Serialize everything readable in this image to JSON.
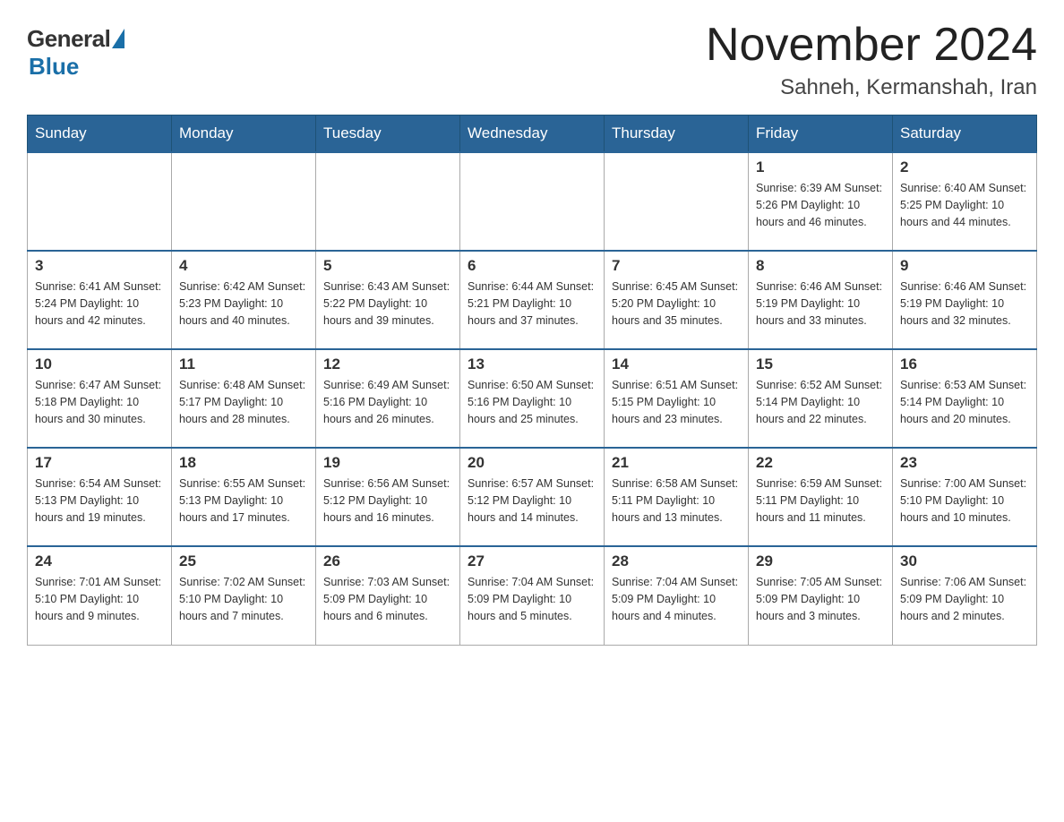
{
  "header": {
    "logo_general": "General",
    "logo_blue": "Blue",
    "month_title": "November 2024",
    "location": "Sahneh, Kermanshah, Iran"
  },
  "days_of_week": [
    "Sunday",
    "Monday",
    "Tuesday",
    "Wednesday",
    "Thursday",
    "Friday",
    "Saturday"
  ],
  "weeks": [
    {
      "days": [
        {
          "num": "",
          "info": ""
        },
        {
          "num": "",
          "info": ""
        },
        {
          "num": "",
          "info": ""
        },
        {
          "num": "",
          "info": ""
        },
        {
          "num": "",
          "info": ""
        },
        {
          "num": "1",
          "info": "Sunrise: 6:39 AM\nSunset: 5:26 PM\nDaylight: 10 hours and 46 minutes."
        },
        {
          "num": "2",
          "info": "Sunrise: 6:40 AM\nSunset: 5:25 PM\nDaylight: 10 hours and 44 minutes."
        }
      ]
    },
    {
      "days": [
        {
          "num": "3",
          "info": "Sunrise: 6:41 AM\nSunset: 5:24 PM\nDaylight: 10 hours and 42 minutes."
        },
        {
          "num": "4",
          "info": "Sunrise: 6:42 AM\nSunset: 5:23 PM\nDaylight: 10 hours and 40 minutes."
        },
        {
          "num": "5",
          "info": "Sunrise: 6:43 AM\nSunset: 5:22 PM\nDaylight: 10 hours and 39 minutes."
        },
        {
          "num": "6",
          "info": "Sunrise: 6:44 AM\nSunset: 5:21 PM\nDaylight: 10 hours and 37 minutes."
        },
        {
          "num": "7",
          "info": "Sunrise: 6:45 AM\nSunset: 5:20 PM\nDaylight: 10 hours and 35 minutes."
        },
        {
          "num": "8",
          "info": "Sunrise: 6:46 AM\nSunset: 5:19 PM\nDaylight: 10 hours and 33 minutes."
        },
        {
          "num": "9",
          "info": "Sunrise: 6:46 AM\nSunset: 5:19 PM\nDaylight: 10 hours and 32 minutes."
        }
      ]
    },
    {
      "days": [
        {
          "num": "10",
          "info": "Sunrise: 6:47 AM\nSunset: 5:18 PM\nDaylight: 10 hours and 30 minutes."
        },
        {
          "num": "11",
          "info": "Sunrise: 6:48 AM\nSunset: 5:17 PM\nDaylight: 10 hours and 28 minutes."
        },
        {
          "num": "12",
          "info": "Sunrise: 6:49 AM\nSunset: 5:16 PM\nDaylight: 10 hours and 26 minutes."
        },
        {
          "num": "13",
          "info": "Sunrise: 6:50 AM\nSunset: 5:16 PM\nDaylight: 10 hours and 25 minutes."
        },
        {
          "num": "14",
          "info": "Sunrise: 6:51 AM\nSunset: 5:15 PM\nDaylight: 10 hours and 23 minutes."
        },
        {
          "num": "15",
          "info": "Sunrise: 6:52 AM\nSunset: 5:14 PM\nDaylight: 10 hours and 22 minutes."
        },
        {
          "num": "16",
          "info": "Sunrise: 6:53 AM\nSunset: 5:14 PM\nDaylight: 10 hours and 20 minutes."
        }
      ]
    },
    {
      "days": [
        {
          "num": "17",
          "info": "Sunrise: 6:54 AM\nSunset: 5:13 PM\nDaylight: 10 hours and 19 minutes."
        },
        {
          "num": "18",
          "info": "Sunrise: 6:55 AM\nSunset: 5:13 PM\nDaylight: 10 hours and 17 minutes."
        },
        {
          "num": "19",
          "info": "Sunrise: 6:56 AM\nSunset: 5:12 PM\nDaylight: 10 hours and 16 minutes."
        },
        {
          "num": "20",
          "info": "Sunrise: 6:57 AM\nSunset: 5:12 PM\nDaylight: 10 hours and 14 minutes."
        },
        {
          "num": "21",
          "info": "Sunrise: 6:58 AM\nSunset: 5:11 PM\nDaylight: 10 hours and 13 minutes."
        },
        {
          "num": "22",
          "info": "Sunrise: 6:59 AM\nSunset: 5:11 PM\nDaylight: 10 hours and 11 minutes."
        },
        {
          "num": "23",
          "info": "Sunrise: 7:00 AM\nSunset: 5:10 PM\nDaylight: 10 hours and 10 minutes."
        }
      ]
    },
    {
      "days": [
        {
          "num": "24",
          "info": "Sunrise: 7:01 AM\nSunset: 5:10 PM\nDaylight: 10 hours and 9 minutes."
        },
        {
          "num": "25",
          "info": "Sunrise: 7:02 AM\nSunset: 5:10 PM\nDaylight: 10 hours and 7 minutes."
        },
        {
          "num": "26",
          "info": "Sunrise: 7:03 AM\nSunset: 5:09 PM\nDaylight: 10 hours and 6 minutes."
        },
        {
          "num": "27",
          "info": "Sunrise: 7:04 AM\nSunset: 5:09 PM\nDaylight: 10 hours and 5 minutes."
        },
        {
          "num": "28",
          "info": "Sunrise: 7:04 AM\nSunset: 5:09 PM\nDaylight: 10 hours and 4 minutes."
        },
        {
          "num": "29",
          "info": "Sunrise: 7:05 AM\nSunset: 5:09 PM\nDaylight: 10 hours and 3 minutes."
        },
        {
          "num": "30",
          "info": "Sunrise: 7:06 AM\nSunset: 5:09 PM\nDaylight: 10 hours and 2 minutes."
        }
      ]
    }
  ]
}
